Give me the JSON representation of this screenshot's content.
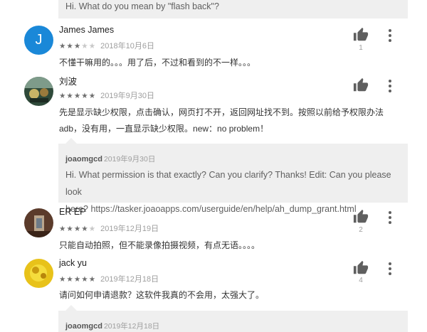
{
  "top_reply": {
    "text": "Hi. What do you mean by \"flash back\"?"
  },
  "reviews": [
    {
      "author": "James James",
      "avatar_letter": "J",
      "rating": 3,
      "date": "2018年10月6日",
      "text": "不懂干嘛用的。。。用了后，不过和看到的不一样。。。",
      "likes": "1"
    },
    {
      "author": "刘波",
      "rating": 5,
      "date": "2019年9月30日",
      "text_line1": "先是显示缺少权限，点击确认，网页打不开，返回网址找不到。按照以前给予权限办法",
      "text_line2": "adb，没有用，一直显示缺少权限。new：no problem！",
      "reply": {
        "name": "joaomgcd",
        "date": "2019年9月30日",
        "line1": "Hi. What permission is that exactly? Can you clarify? Thanks! Edit: Can you please look",
        "line2": "here? https://tasker.joaoapps.com/userguide/en/help/ah_dump_grant.html"
      }
    },
    {
      "author": "ER EP",
      "rating": 4,
      "date": "2019年12月19日",
      "text": "只能自动拍照，但不能录像拍摄视频，有点无语。。。。",
      "likes": "2"
    },
    {
      "author": "jack yu",
      "rating": 5,
      "date": "2019年12月18日",
      "text": "请问如何申请退款？这软件我真的不会用，太强大了。",
      "likes": "4",
      "reply": {
        "name": "joaomgcd",
        "date": "2019年12月18日"
      }
    }
  ],
  "colors": {
    "avatar_j": "#1a88d8",
    "reply_bg": "#efefef",
    "icon": "#5f5f5f"
  }
}
